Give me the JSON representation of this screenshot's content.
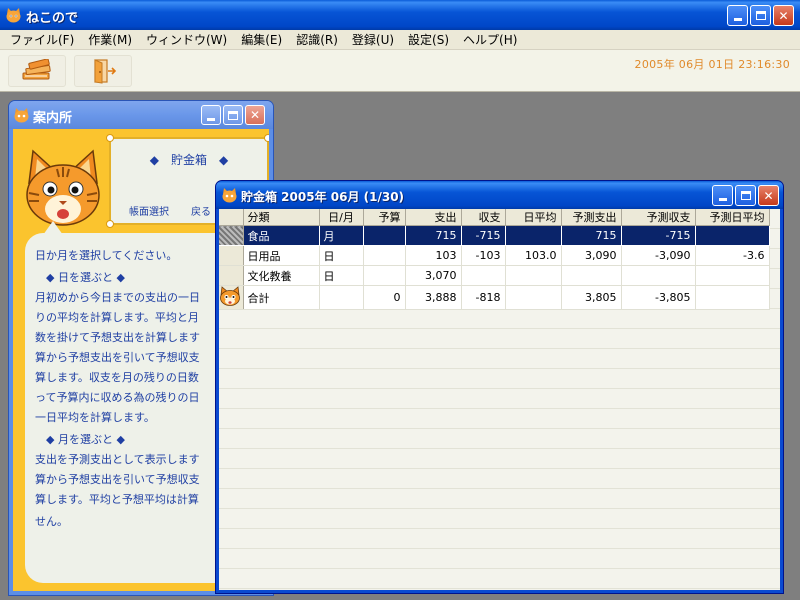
{
  "app": {
    "title": "ねこので",
    "menu": [
      "ファイル(F)",
      "作業(M)",
      "ウィンドウ(W)",
      "編集(E)",
      "認識(R)",
      "登録(U)",
      "設定(S)",
      "ヘルプ(H)"
    ],
    "datetime": "2005年 06月 01日 23:16:30",
    "toolbar_icons": [
      "books-icon",
      "exit-door-icon"
    ]
  },
  "guide": {
    "title": "案内所",
    "sign": {
      "title": "◆　貯金箱　◆",
      "link1": "帳面選択",
      "link2": "戻る"
    },
    "lines": [
      "日か月を選択してください。",
      "　◆ 日を選ぶと ◆",
      "月初めから今日までの支出の一日",
      "りの平均を計算します。平均と月",
      "数を掛けて予想支出を計算します",
      "算から予想支出を引いて予想収支",
      "算します。収支を月の残りの日数",
      "って予算内に収める為の残りの日",
      "一日平均を計算します。",
      "　◆ 月を選ぶと ◆",
      "支出を予測支出として表示します",
      "算から予想支出を引いて予想収支",
      "算します。平均と予想平均は計算",
      "せん。"
    ]
  },
  "kakeibo": {
    "title": "貯金箱 2005年 06月 (1/30)",
    "columns": [
      "分類",
      "日/月",
      "予算",
      "支出",
      "収支",
      "日平均",
      "予測支出",
      "予測収支",
      "予測日平均"
    ],
    "rows": [
      {
        "cells": [
          "食品",
          "月",
          "",
          "715",
          "-715",
          "",
          "715",
          "-715",
          ""
        ],
        "selected": true,
        "icon": false
      },
      {
        "cells": [
          "日用品",
          "日",
          "",
          "103",
          "-103",
          "103.0",
          "3,090",
          "-3,090",
          "-3.6"
        ],
        "selected": false,
        "icon": false
      },
      {
        "cells": [
          "文化教養",
          "日",
          "",
          "3,070",
          "",
          "",
          "",
          "",
          ""
        ],
        "selected": false,
        "icon": false
      },
      {
        "cells": [
          "合計",
          "",
          "0",
          "3,888",
          "-818",
          "",
          "3,805",
          "-3,805",
          ""
        ],
        "selected": false,
        "icon": true
      }
    ]
  }
}
